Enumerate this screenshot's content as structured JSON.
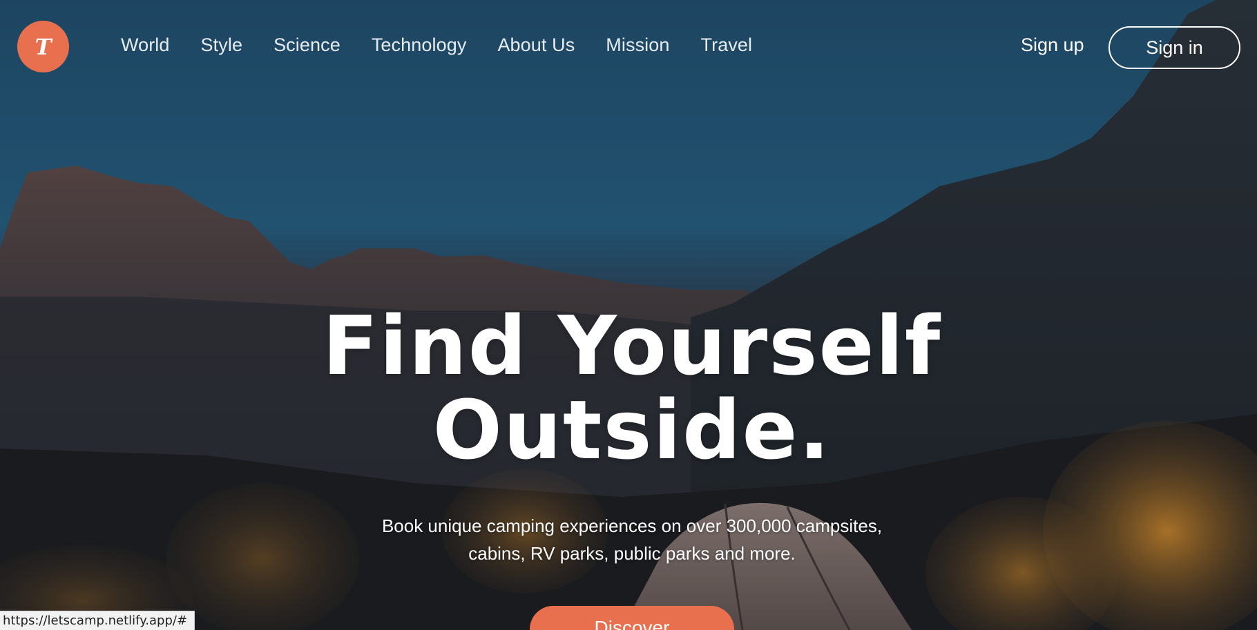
{
  "brand": {
    "logo_letter": "T",
    "accent_color": "#e8704f"
  },
  "nav": {
    "items": [
      {
        "label": "World"
      },
      {
        "label": "Style"
      },
      {
        "label": "Science"
      },
      {
        "label": "Technology"
      },
      {
        "label": "About Us"
      },
      {
        "label": "Mission"
      },
      {
        "label": "Travel"
      }
    ]
  },
  "auth": {
    "signup_label": "Sign up",
    "signin_label": "Sign in"
  },
  "hero": {
    "headline_line1": "Find Yourself",
    "headline_line2": "Outside.",
    "subtitle_line1": "Book unique camping experiences on over 300,000 campsites,",
    "subtitle_line2": "cabins, RV parks, public parks and more.",
    "cta_label": "Discover"
  },
  "status_bar": {
    "url": "https://letscamp.netlify.app/#"
  }
}
